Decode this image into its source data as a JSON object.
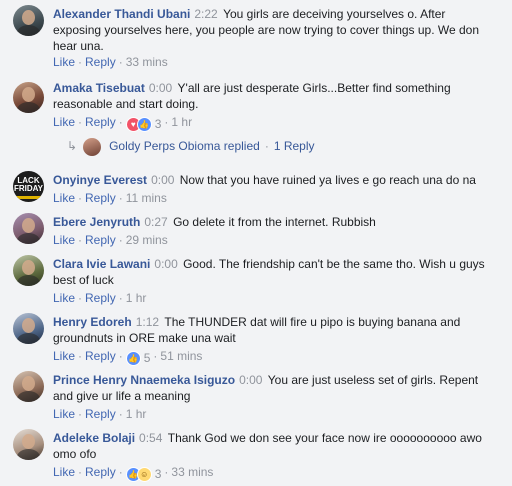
{
  "actions": {
    "like": "Like",
    "reply": "Reply",
    "separator": "·"
  },
  "comments": [
    {
      "name": "Alexander Thandi Ubani",
      "duration": "2:22",
      "text": "You girls are deceiving yourselves o. After exposing yourselves here, you people are now trying to cover things up. We don hear una.",
      "age": "33 mins"
    },
    {
      "name": "Amaka Tisebuat",
      "duration": "0:00",
      "text": "Y'all are just desperate Girls...Better find something reasonable and start doing.",
      "age": "1 hr",
      "reactions": {
        "icons": [
          "heart-reaction-icon",
          "like-reaction-icon"
        ],
        "count": "3"
      }
    },
    {
      "name": "Onyinye Everest",
      "duration": "0:00",
      "text": "Now that you have ruined ya lives e go reach una do na",
      "age": "11 mins",
      "avatar_text": [
        "LACK",
        "FRIDAY"
      ]
    },
    {
      "name": "Ebere Jenyruth",
      "duration": "0:27",
      "text": "Go delete it from the internet. Rubbish",
      "age": "29 mins"
    },
    {
      "name": "Clara Ivie Lawani",
      "duration": "0:00",
      "text": "Good. The friendship can't be the same tho. Wish u guys best of luck",
      "age": "1 hr"
    },
    {
      "name": "Henry Edoreh",
      "duration": "1:12",
      "text": "The THUNDER dat will fire u pipo is buying banana and groundnuts in ORE make una wait",
      "age": "51 mins",
      "reactions": {
        "icons": [
          "like-reaction-icon"
        ],
        "count": "5"
      }
    },
    {
      "name": "Prince Henry Nnaemeka Isiguzo",
      "duration": "0:00",
      "text": "You are just useless set of girls. Repent and give ur life a meaning",
      "age": "1 hr"
    },
    {
      "name": "Adeleke Bolaji",
      "duration": "0:54",
      "text": "Thank God we don see your face now ire oooooooooo awo omo ofo",
      "age": "33 mins",
      "reactions": {
        "icons": [
          "like-reaction-icon",
          "haha-reaction-icon"
        ],
        "count": "3"
      }
    }
  ],
  "reply_summary": {
    "name": "Goldy Perps Obioma replied",
    "separator": "·",
    "count": "1 Reply"
  },
  "colors": {
    "link": "#4267b2",
    "name": "#385898",
    "meta": "#90949c",
    "background": "#f2f3f5"
  }
}
